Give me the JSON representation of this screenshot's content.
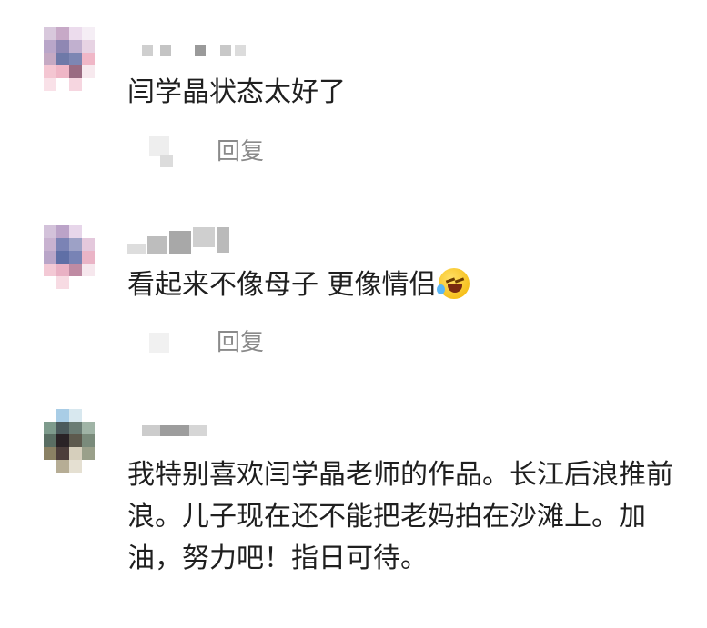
{
  "comments": [
    {
      "text": "闫学晶状态太好了",
      "reply_label": "回复"
    },
    {
      "text": "看起来不像母子 更像情侣",
      "reply_label": "回复",
      "emoji": "laughing-tears-emoji"
    },
    {
      "text": "我特别喜欢闫学晶老师的作品。长江后浪推前浪。儿子现在还不能把老妈拍在沙滩上。加油，努力吧！指日可待。"
    }
  ]
}
